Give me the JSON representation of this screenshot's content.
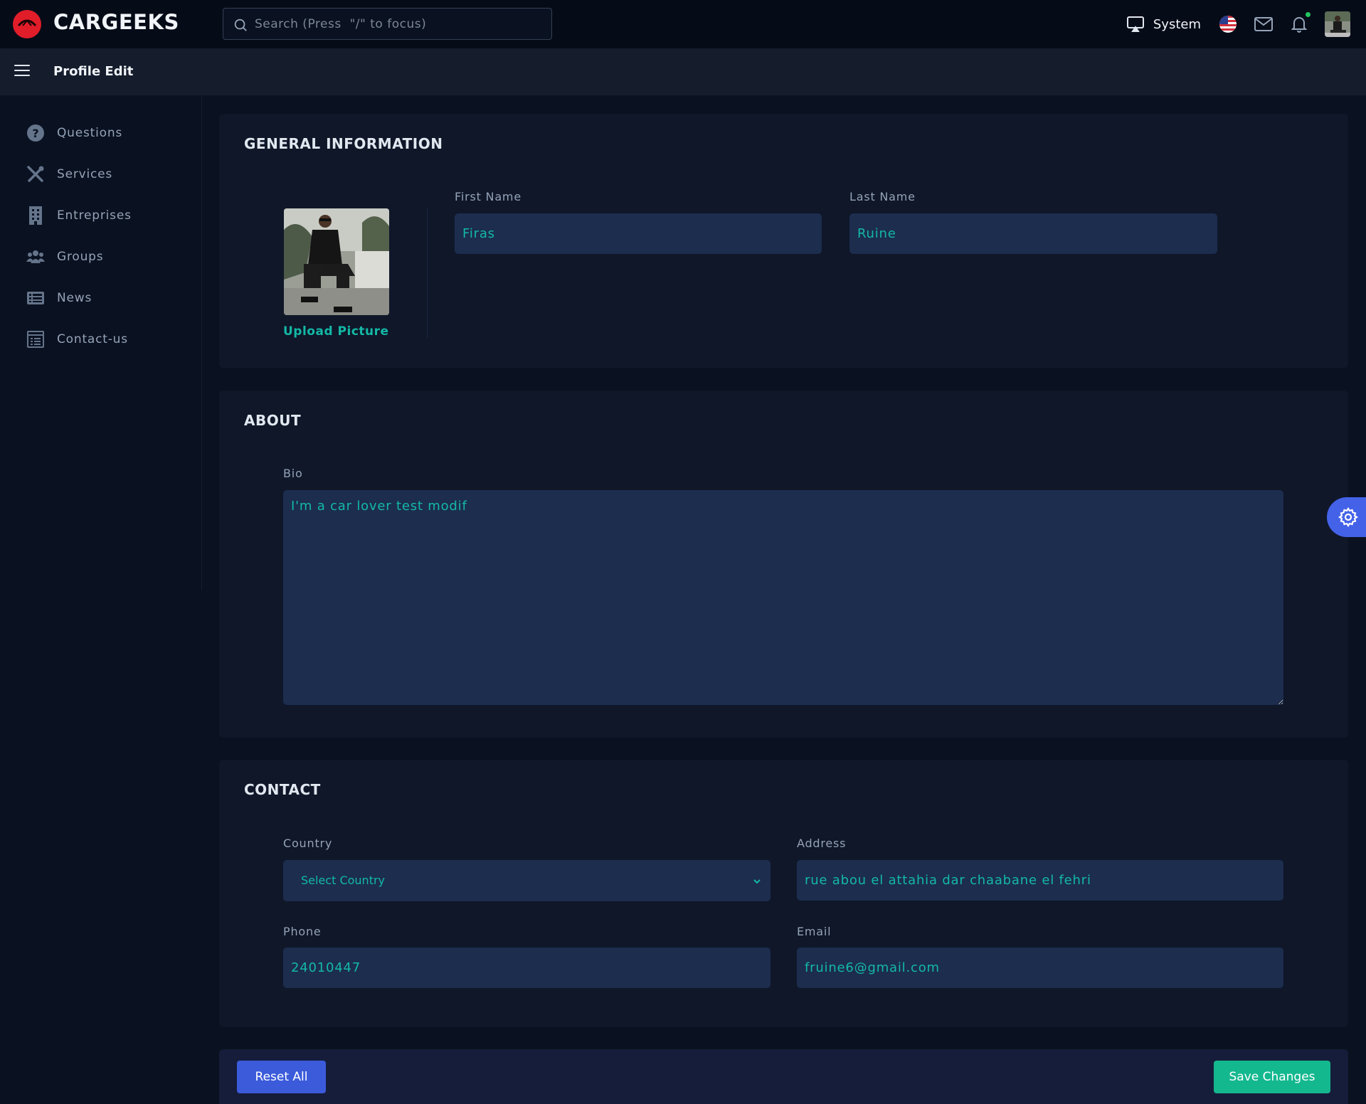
{
  "app": {
    "brand": "CARGEEKS",
    "search_placeholder": "Search (Press  \"/\" to focus)",
    "system_label": "System"
  },
  "subheader": {
    "title": "Profile Edit"
  },
  "sidebar": {
    "items": [
      {
        "label": "Questions",
        "icon": "question-circle-icon"
      },
      {
        "label": "Services",
        "icon": "tools-icon"
      },
      {
        "label": "Entreprises",
        "icon": "building-icon"
      },
      {
        "label": "Groups",
        "icon": "users-icon"
      },
      {
        "label": "News",
        "icon": "newspaper-icon"
      },
      {
        "label": "Contact-us",
        "icon": "contact-form-icon"
      }
    ]
  },
  "general": {
    "title": "GENERAL INFORMATION",
    "upload_label": "Upload Picture",
    "first_name_label": "First Name",
    "first_name_value": "Firas",
    "last_name_label": "Last Name",
    "last_name_value": "Ruine"
  },
  "about": {
    "title": "ABOUT",
    "bio_label": "Bio",
    "bio_value": "I'm a car lover test modif"
  },
  "contact": {
    "title": "CONTACT",
    "country_label": "Country",
    "country_value": "Select Country",
    "address_label": "Address",
    "address_value": "rue abou el attahia dar chaabane el fehri",
    "phone_label": "Phone",
    "phone_value": "24010447",
    "email_label": "Email",
    "email_value": "fruine6@gmail.com"
  },
  "actions": {
    "reset_label": "Reset All",
    "save_label": "Save Changes"
  },
  "colors": {
    "accent_teal": "#14b8a6",
    "primary_blue": "#3b5bdb",
    "save_green": "#14b88f",
    "brand_red": "#e11d2a"
  }
}
